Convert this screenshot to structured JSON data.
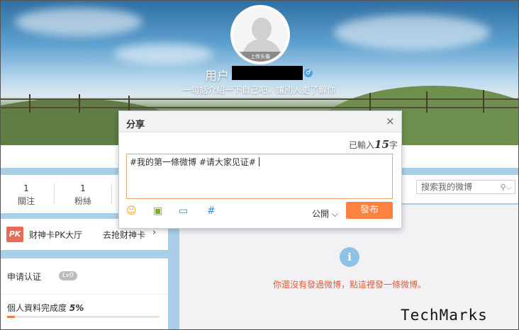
{
  "profile": {
    "avatar_caption": "上传头像",
    "username_prefix": "用户",
    "gender_symbol": "♂",
    "intro": "一句話介紹一下自己吧，讓別人更了解你"
  },
  "stats": [
    {
      "count": "1",
      "label": "關注"
    },
    {
      "count": "1",
      "label": "粉絲"
    }
  ],
  "search": {
    "placeholder": "搜索我的微博",
    "icon": "magnifier-dropdown-icon"
  },
  "pk": {
    "badge": "PK",
    "title": "财神卡PK大厅",
    "link": "去抢财神卡",
    "chevron": "›"
  },
  "verify": {
    "title": "申请认证",
    "level": "Lv0",
    "completion_label": "個人資料完成度",
    "completion_value": "5%",
    "completion_fraction": 0.05
  },
  "feed": {
    "info_symbol": "i",
    "empty_text": "你還沒有發過微博，點這裡發一條微博。"
  },
  "dialog": {
    "title": "分享",
    "close": "×",
    "counter_prefix": "已輸入",
    "counter_value": "15",
    "counter_suffix": "字",
    "content": "#我的第一條微博 #请大家见证#",
    "visibility": "公開",
    "visibility_chevron": "⌵",
    "post_label": "發布",
    "tools": [
      {
        "icon": "smiley-icon",
        "glyph": "☺",
        "color": "#f0a31a"
      },
      {
        "icon": "image-icon",
        "glyph": "▣",
        "color": "#7ab800"
      },
      {
        "icon": "video-icon",
        "glyph": "▭",
        "color": "#3a8fd0"
      },
      {
        "icon": "topic-hash-icon",
        "glyph": "#",
        "color": "#3a8fd0"
      }
    ]
  },
  "watermark": "TechMarks"
}
